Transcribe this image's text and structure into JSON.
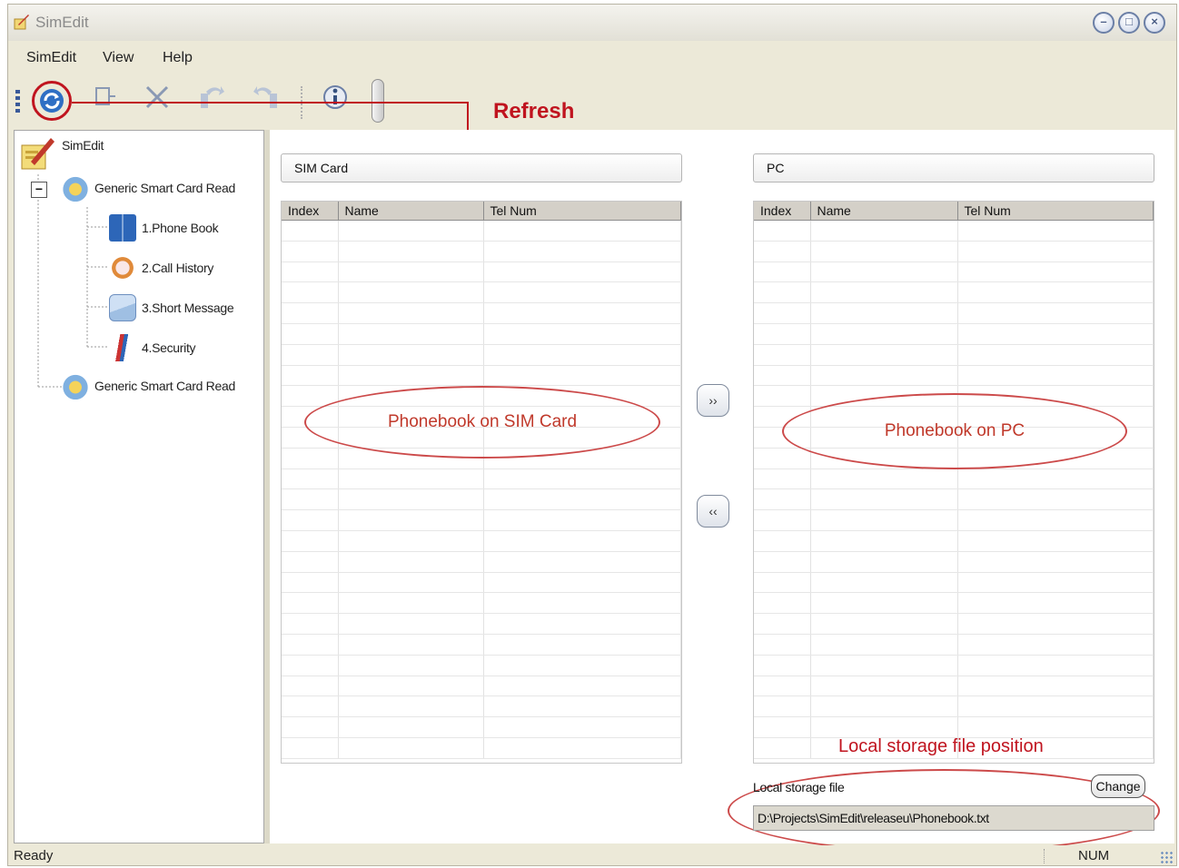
{
  "window": {
    "title": "SimEdit"
  },
  "menu": [
    "SimEdit",
    "View",
    "Help"
  ],
  "toolbar": {
    "buttons": [
      "refresh-icon",
      "new-record-icon",
      "delete-icon",
      "import-icon",
      "export-icon",
      "about-icon",
      "signal-icon"
    ],
    "annotation": "Refresh"
  },
  "tree": {
    "root": "SimEdit",
    "reader1": "Generic Smart Card Read",
    "items": [
      "1.Phone Book",
      "2.Call History",
      "3.Short Message",
      "4.Security"
    ],
    "reader2": "Generic Smart Card Read",
    "expander": "−"
  },
  "sim_panel": {
    "title": "SIM Card",
    "columns": [
      "Index",
      "Name",
      "Tel Num"
    ],
    "annotation": "Phonebook on SIM Card"
  },
  "pc_panel": {
    "title": "PC",
    "columns": [
      "Index",
      "Name",
      "Tel Num"
    ],
    "annotation": "Phonebook on PC"
  },
  "transfer": {
    "to_pc": "››",
    "to_sim": "‹‹"
  },
  "storage": {
    "annotation": "Local storage file position",
    "label": "Local storage file",
    "change_button": "Change",
    "path": "D:\\Projects\\SimEdit\\releaseu\\Phonebook.txt"
  },
  "status": {
    "text": "Ready",
    "num": "NUM"
  },
  "colors": {
    "annotation_red": "#c0141f",
    "ellipse_red": "#cc4a4a",
    "header_gray": "#d4d0c8"
  }
}
